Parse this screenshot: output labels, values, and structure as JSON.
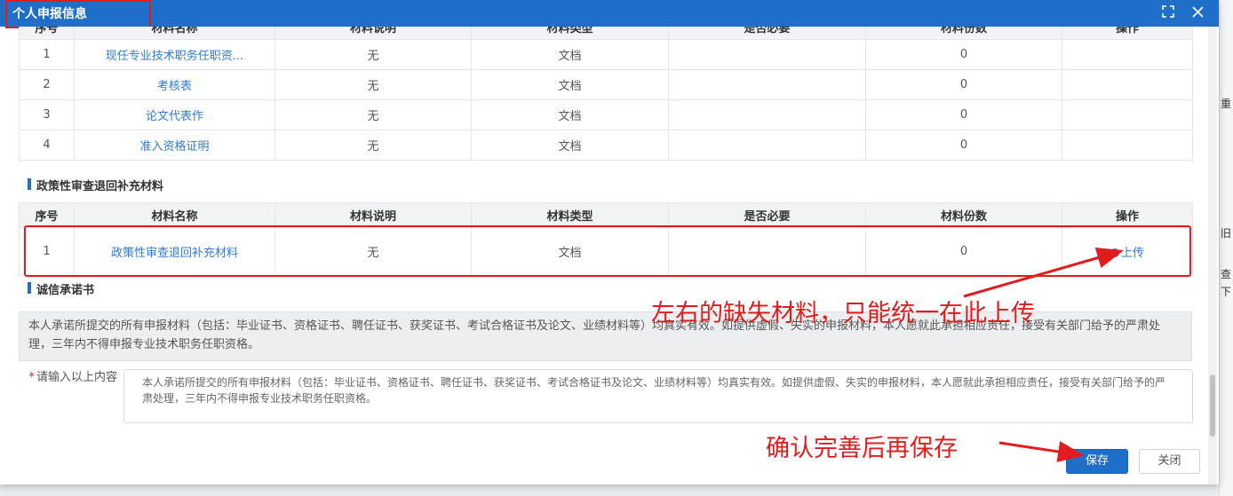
{
  "modal": {
    "title": "个人申报信息",
    "fullscreen_icon": "fullscreen-icon",
    "close_icon": "close-icon"
  },
  "top_table": {
    "rows": [
      {
        "seq": "1",
        "name": "现任专业技术职务任职资...",
        "desc": "无",
        "type": "文档",
        "required": "",
        "count": "0",
        "op": ""
      },
      {
        "seq": "2",
        "name": "考核表",
        "desc": "无",
        "type": "文档",
        "required": "",
        "count": "0",
        "op": ""
      },
      {
        "seq": "3",
        "name": "论文代表作",
        "desc": "无",
        "type": "文档",
        "required": "",
        "count": "0",
        "op": ""
      },
      {
        "seq": "4",
        "name": "准入资格证明",
        "desc": "无",
        "type": "文档",
        "required": "",
        "count": "0",
        "op": ""
      }
    ]
  },
  "policy_section": {
    "title": "政策性审查退回补充材料",
    "headers": [
      "序号",
      "材料名称",
      "材料说明",
      "材料类型",
      "是否必要",
      "材料份数",
      "操作"
    ],
    "rows": [
      {
        "seq": "1",
        "name": "政策性审查退回补充材料",
        "desc": "无",
        "type": "文档",
        "required": "",
        "count": "0",
        "op": "上传"
      }
    ]
  },
  "pledge_section": {
    "title": "诚信承诺书",
    "text": "本人承诺所提交的所有申报材料（包括：毕业证书、资格证书、聘任证书、获奖证书、考试合格证书及论文、业绩材料等）均真实有效。如提供虚假、失实的申报材料，本人愿就此承担相应责任，接受有关部门给予的严肃处理，三年内不得申报专业技术职务任职资格。",
    "field_label": "请输入以上内容",
    "field_value": "本人承诺所提交的所有申报材料（包括：毕业证书、资格证书、聘任证书、获奖证书、考试合格证书及论文、业绩材料等）均真实有效。如提供虚假、失实的申报材料，本人愿就此承担相应责任，接受有关部门给予的严肃处理，三年内不得申报专业技术职务任职资格。"
  },
  "annotations": {
    "upload_note": "左右的缺失材料，只能统一在此上传",
    "save_note": "确认完善后再保存",
    "color": "#e21c1c"
  },
  "buttons": {
    "save": "保存",
    "close": "关闭"
  },
  "right_edge_fragments": [
    "重",
    "旧",
    "查",
    "下"
  ],
  "colors": {
    "header": "#1f6fc8",
    "link": "#2f7ad8",
    "save_button": "#1f6fc8"
  }
}
